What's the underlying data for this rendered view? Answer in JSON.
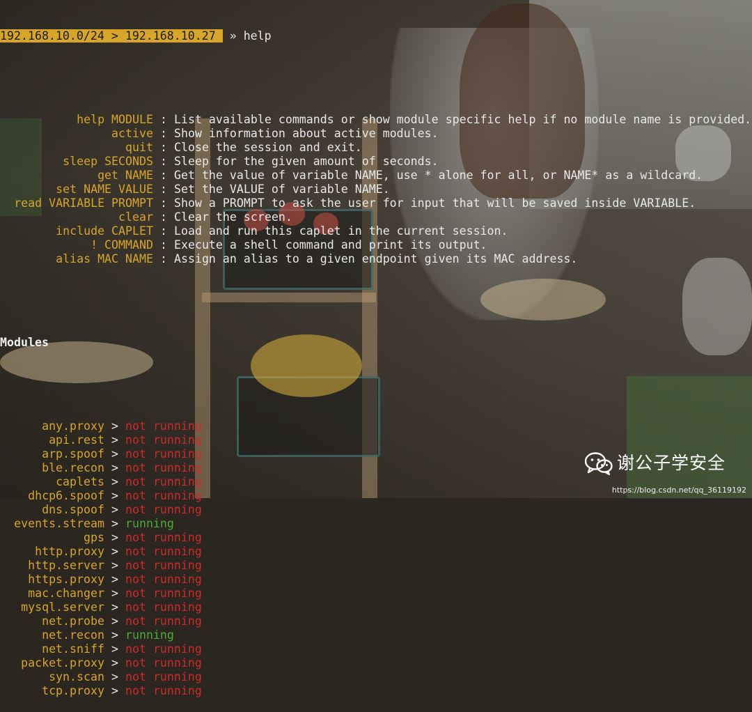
{
  "prompt": {
    "session": "192.168.10.0/24 > 192.168.10.27 ",
    "separator": " » ",
    "command": "help"
  },
  "help": [
    {
      "cmd": "help MODULE",
      "desc": "List available commands or show module specific help if no module name is provided."
    },
    {
      "cmd": "active",
      "desc": "Show information about active modules."
    },
    {
      "cmd": "quit",
      "desc": "Close the session and exit."
    },
    {
      "cmd": "sleep SECONDS",
      "desc": "Sleep for the given amount of seconds."
    },
    {
      "cmd": "get NAME",
      "desc": "Get the value of variable NAME, use * alone for all, or NAME* as a wildcard."
    },
    {
      "cmd": "set NAME VALUE",
      "desc": "Set the VALUE of variable NAME."
    },
    {
      "cmd": "read VARIABLE PROMPT",
      "desc": "Show a PROMPT to ask the user for input that will be saved inside VARIABLE."
    },
    {
      "cmd": "clear",
      "desc": "Clear the screen."
    },
    {
      "cmd": "include CAPLET",
      "desc": "Load and run this caplet in the current session."
    },
    {
      "cmd": "! COMMAND",
      "desc": "Execute a shell command and print its output."
    },
    {
      "cmd": "alias MAC NAME",
      "desc": "Assign an alias to a given endpoint given its MAC address."
    }
  ],
  "modules_title": "Modules",
  "modules": [
    {
      "name": "any.proxy",
      "status": "not running"
    },
    {
      "name": "api.rest",
      "status": "not running"
    },
    {
      "name": "arp.spoof",
      "status": "not running"
    },
    {
      "name": "ble.recon",
      "status": "not running"
    },
    {
      "name": "caplets",
      "status": "not running"
    },
    {
      "name": "dhcp6.spoof",
      "status": "not running"
    },
    {
      "name": "dns.spoof",
      "status": "not running"
    },
    {
      "name": "events.stream",
      "status": "running"
    },
    {
      "name": "gps",
      "status": "not running"
    },
    {
      "name": "http.proxy",
      "status": "not running"
    },
    {
      "name": "http.server",
      "status": "not running"
    },
    {
      "name": "https.proxy",
      "status": "not running"
    },
    {
      "name": "mac.changer",
      "status": "not running"
    },
    {
      "name": "mysql.server",
      "status": "not running"
    },
    {
      "name": "net.probe",
      "status": "not running"
    },
    {
      "name": "net.recon",
      "status": "running"
    },
    {
      "name": "net.sniff",
      "status": "not running"
    },
    {
      "name": "packet.proxy",
      "status": "not running"
    },
    {
      "name": "syn.scan",
      "status": "not running"
    },
    {
      "name": "tcp.proxy",
      "status": "not running"
    }
  ],
  "watermark": {
    "icon": "wechat-icon",
    "text": "谢公子学安全",
    "url": "https://blog.csdn.net/qq_36119192"
  },
  "colors": {
    "prompt_bg": "#d6a52a",
    "command_name": "#d6a52a",
    "not_running": "#cc2a2a",
    "running": "#4caa3a",
    "text": "#e8e8e8"
  }
}
